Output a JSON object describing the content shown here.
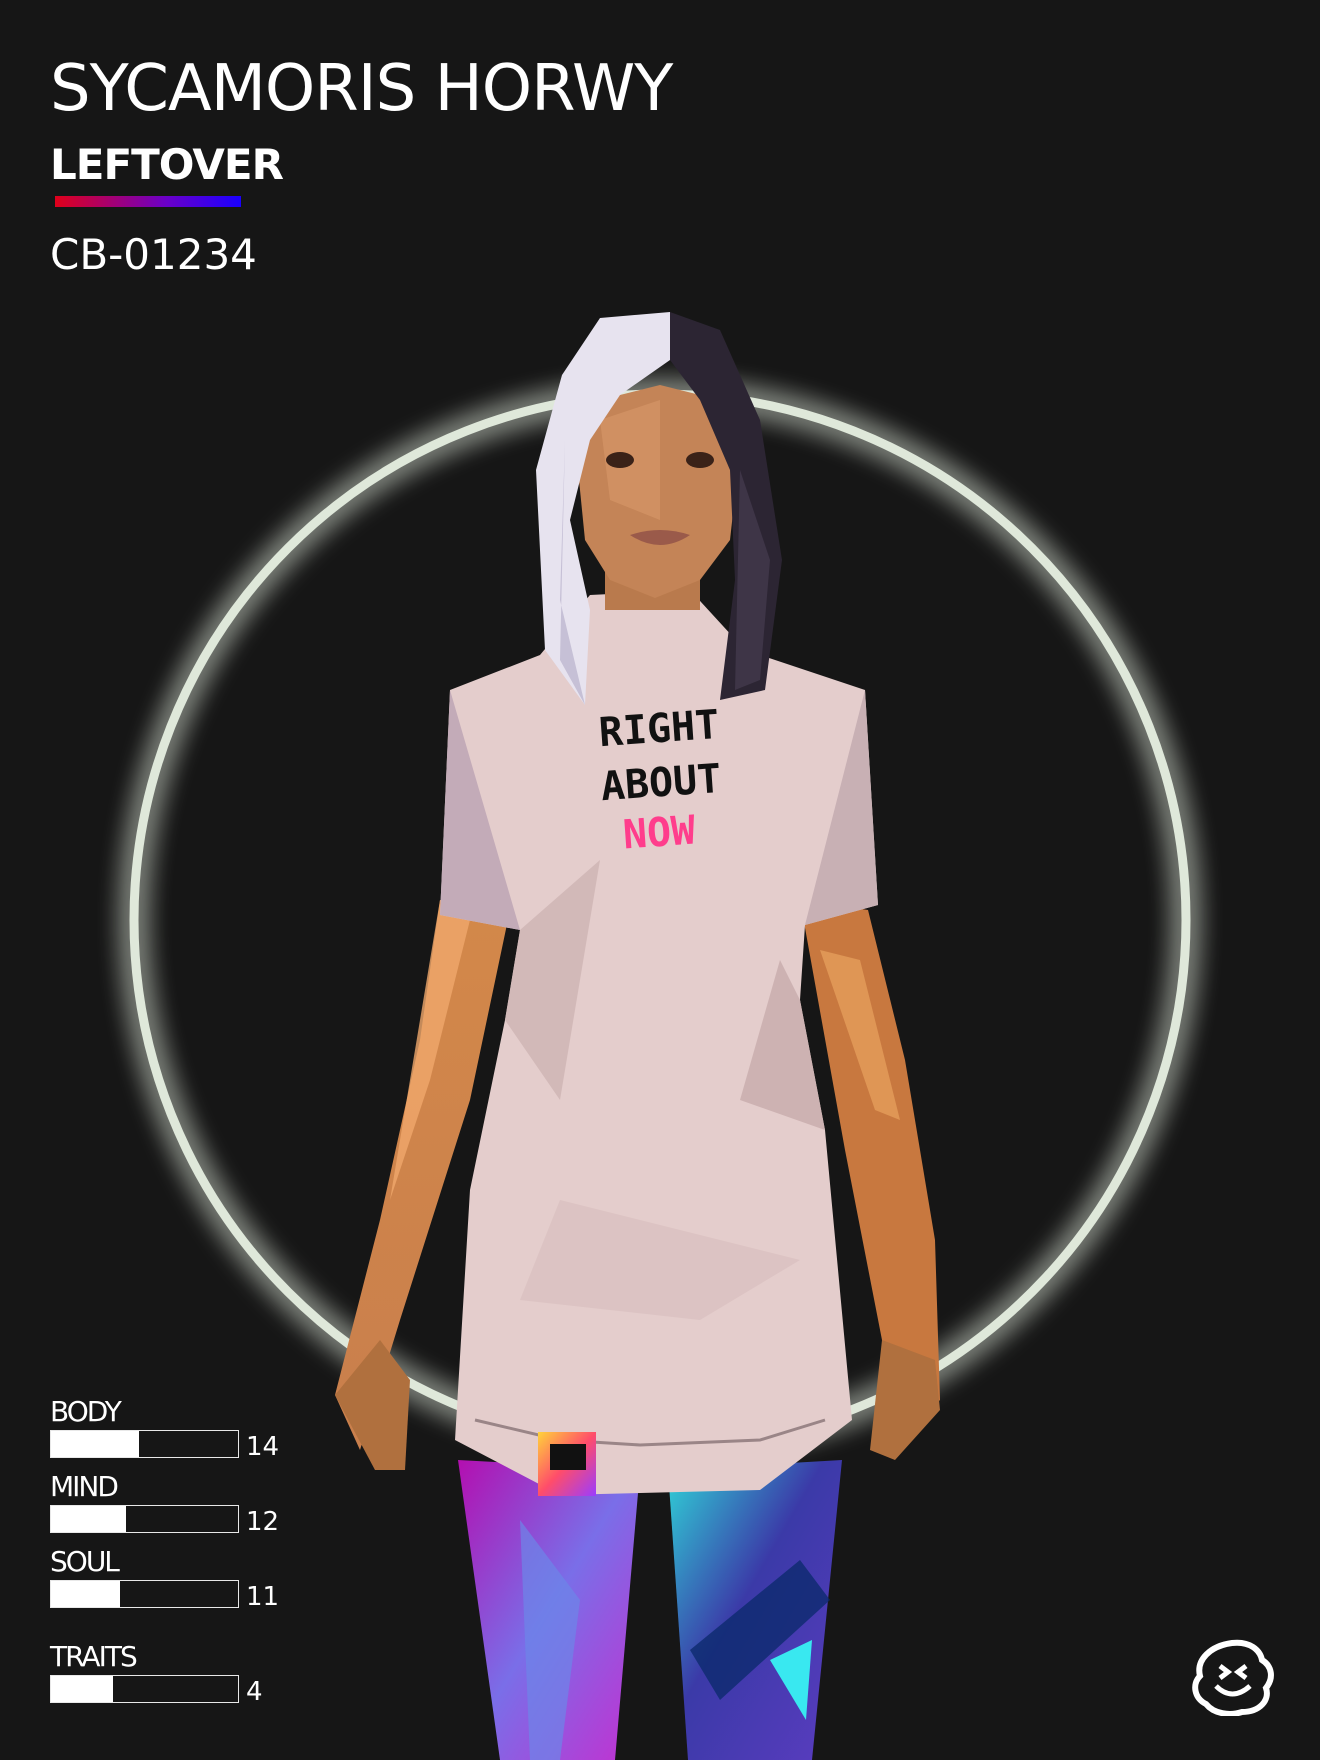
{
  "card": {
    "name": "SYCAMORIS HORWY",
    "class": "LEFTOVER",
    "serial": "CB-01234"
  },
  "shirt": {
    "line1": "RIGHT",
    "line2": "ABOUT",
    "line3": "NOW"
  },
  "stats": [
    {
      "label": "BODY",
      "value": "14",
      "fill": 0.47
    },
    {
      "label": "MIND",
      "value": "12",
      "fill": 0.4
    },
    {
      "label": "SOUL",
      "value": "11",
      "fill": 0.37
    },
    {
      "label": "TRAITS",
      "value": "4",
      "fill": 0.33
    }
  ],
  "icons": {
    "logo": "smiley-face-icon"
  },
  "colors": {
    "background": "#161616",
    "ring": "#dfe8da",
    "accent_start": "#e0001a",
    "accent_end": "#1a00ff",
    "shirt": "#e4cdcc",
    "shirt_text": "#111111",
    "shirt_text_accent": "#ff3d8c"
  }
}
